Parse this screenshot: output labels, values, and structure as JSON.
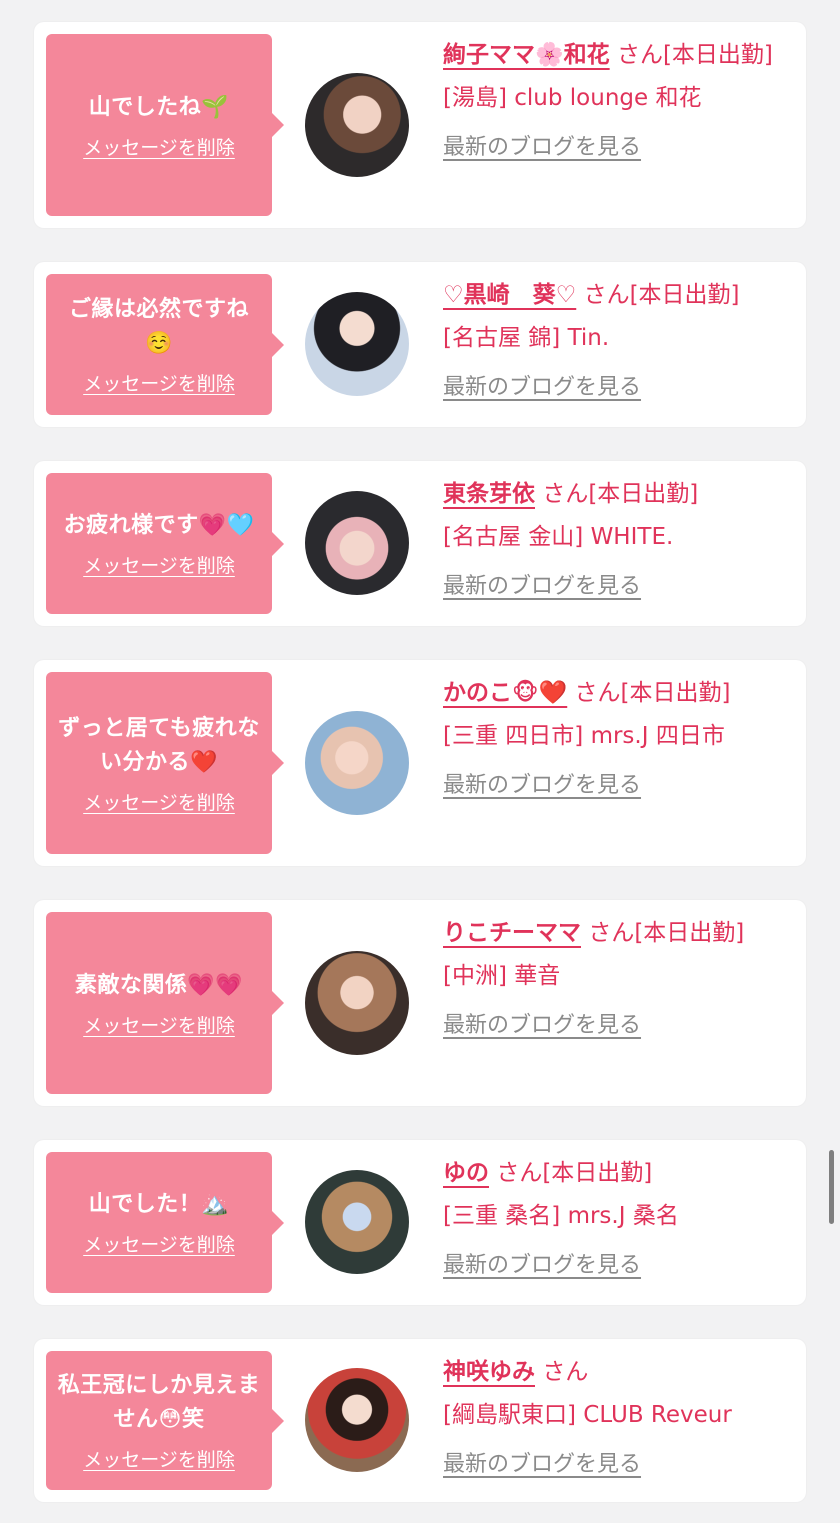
{
  "cards": [
    {
      "message": "山でしたね🌱",
      "delete_label": "メッセージを削除",
      "name": "絢子ママ🌸和花",
      "suffix": "さん[本日出勤]",
      "shop": "[湯島] club lounge 和花",
      "blog_label": "最新のブログを見る"
    },
    {
      "message": "ご縁は必然ですね☺️",
      "delete_label": "メッセージを削除",
      "name": "♡黒崎　葵♡",
      "suffix": "さん[本日出勤]",
      "shop": "[名古屋 錦] Tin.",
      "blog_label": "最新のブログを見る"
    },
    {
      "message": "お疲れ様です💗🩵",
      "delete_label": "メッセージを削除",
      "name": "東条芽依",
      "suffix": "さん[本日出勤]",
      "shop": "[名古屋 金山] WHITE.",
      "blog_label": "最新のブログを見る"
    },
    {
      "message": "ずっと居ても疲れない分かる❤️",
      "delete_label": "メッセージを削除",
      "name": "かのこ🐵❤️",
      "suffix": "さん[本日出勤]",
      "shop": "[三重 四日市] mrs.J 四日市",
      "blog_label": "最新のブログを見る"
    },
    {
      "message": "素敵な関係💗💗",
      "delete_label": "メッセージを削除",
      "name": "りこチーママ",
      "suffix": "さん[本日出勤]",
      "shop": "[中洲] 華音",
      "blog_label": "最新のブログを見る"
    },
    {
      "message": "山でした！🏔️",
      "delete_label": "メッセージを削除",
      "name": "ゆの",
      "suffix": "さん[本日出勤]",
      "shop": "[三重 桑名] mrs.J 桑名",
      "blog_label": "最新のブログを見る"
    },
    {
      "message": "私王冠にしか見えません😳笑",
      "delete_label": "メッセージを削除",
      "name": "神咲ゆみ",
      "suffix": "さん",
      "shop": "[綱島駅東口] CLUB Reveur",
      "blog_label": "最新のブログを見る"
    }
  ],
  "colors": {
    "accent": "#e0335a",
    "bubble": "#f4879a",
    "link_gray": "#8a8a8a",
    "background": "#f2f2f3"
  }
}
